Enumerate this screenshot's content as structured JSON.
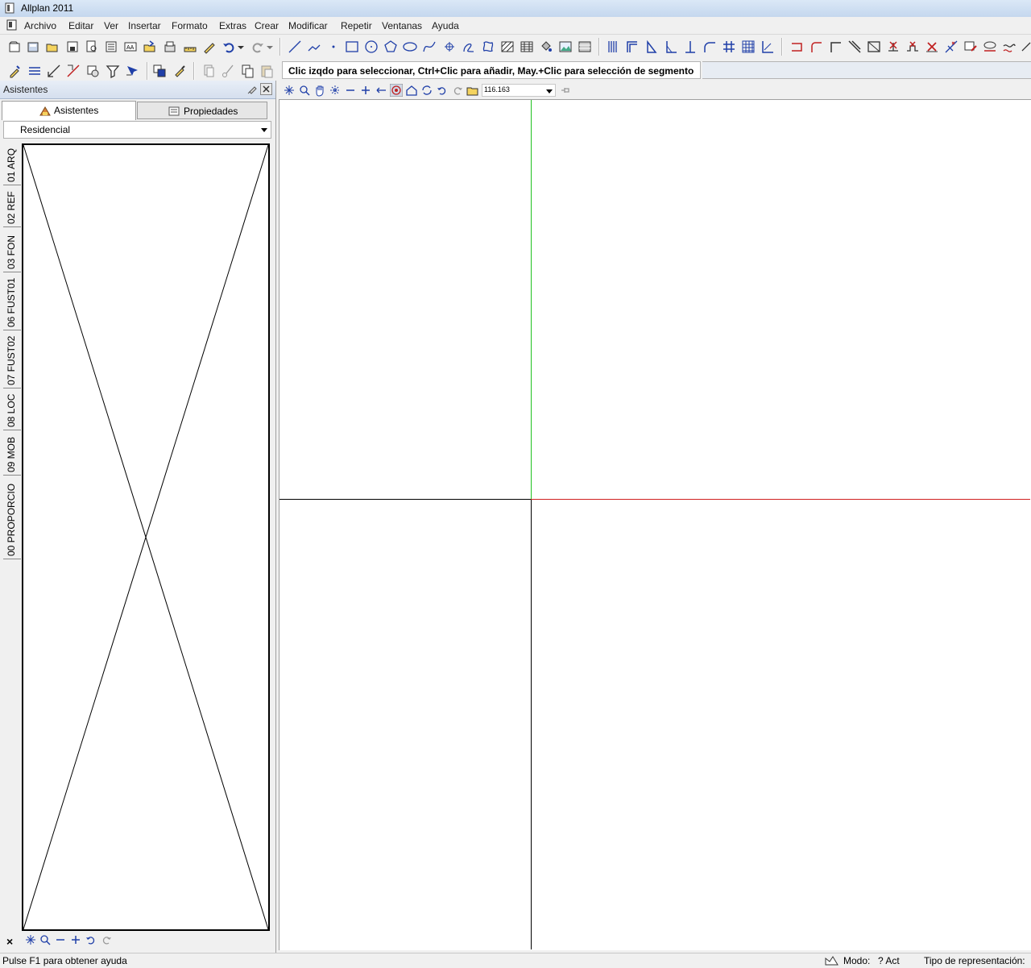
{
  "window": {
    "title": "Allplan 2011"
  },
  "menu": {
    "items": [
      "Archivo",
      "Editar",
      "Ver",
      "Insertar",
      "Formato",
      "Extras",
      "Crear",
      "Modificar",
      "Repetir",
      "Ventanas",
      "Ayuda"
    ]
  },
  "hint": {
    "text": "Clic izqdo para seleccionar, Ctrl+Clic para añadir, May.+Clic para selección de segmento"
  },
  "panel": {
    "title": "Asistentes",
    "tabs": [
      "Asistentes",
      "Propiedades"
    ],
    "dropdown_value": "Residencial",
    "vertical_tabs": [
      "01 ARQ",
      "02 REF",
      "03 FON",
      "06 FUST01",
      "07 FUST02",
      "08 LOC",
      "09 MOB",
      "00 PROPORCIO"
    ],
    "close_label": "×"
  },
  "viewbar": {
    "scale_value": "116.163"
  },
  "statusbar": {
    "help": "Pulse F1 para obtener ayuda",
    "mode_label": "Modo:",
    "mode_value": "? Act",
    "display_label": "Tipo de representación:"
  },
  "colors": {
    "axis_x": "#d02020",
    "axis_y": "#20c020",
    "accent": "#1f3fa8"
  }
}
